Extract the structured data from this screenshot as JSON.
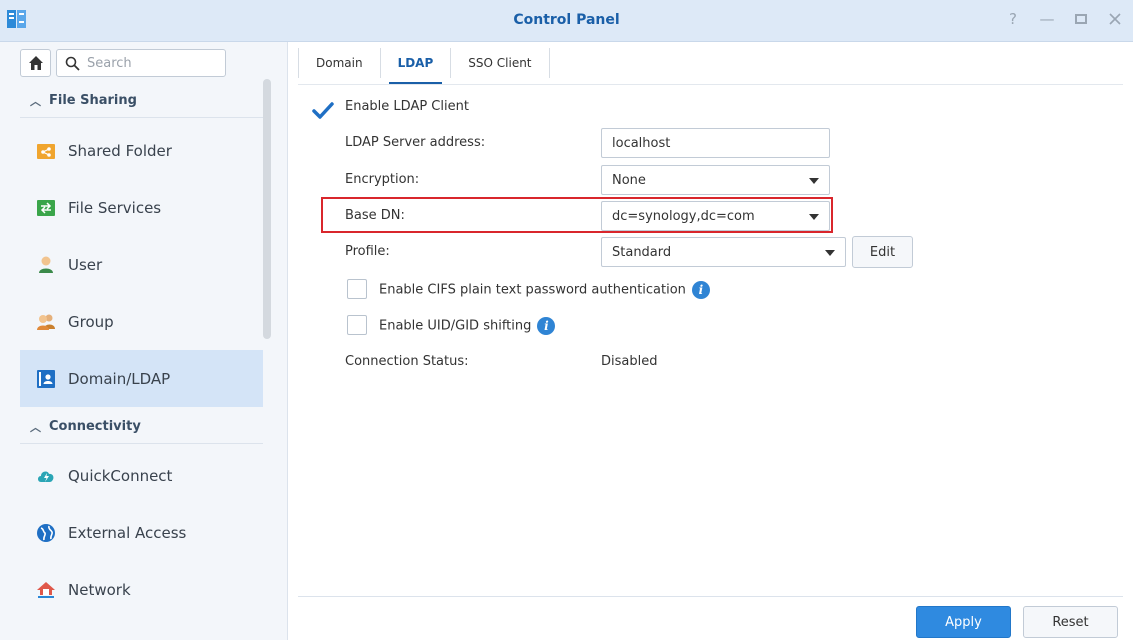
{
  "window": {
    "title": "Control Panel"
  },
  "colors": {
    "accent": "#1a5fa8",
    "primary_button": "#2f8ae0",
    "active_nav": "#d4e4f7",
    "highlight_border": "#d9262c"
  },
  "sidebar": {
    "search": {
      "placeholder": "Search"
    },
    "sections": [
      {
        "label": "File Sharing"
      },
      {
        "label": "Connectivity"
      }
    ],
    "items": [
      {
        "label": "Shared Folder",
        "icon": "shared-folder-icon"
      },
      {
        "label": "File Services",
        "icon": "file-services-icon"
      },
      {
        "label": "User",
        "icon": "user-icon"
      },
      {
        "label": "Group",
        "icon": "group-icon"
      },
      {
        "label": "Domain/LDAP",
        "icon": "domain-ldap-icon",
        "active": true
      },
      {
        "label": "QuickConnect",
        "icon": "quickconnect-icon"
      },
      {
        "label": "External Access",
        "icon": "external-access-icon"
      },
      {
        "label": "Network",
        "icon": "network-icon"
      }
    ]
  },
  "tabs": [
    {
      "label": "Domain"
    },
    {
      "label": "LDAP",
      "active": true
    },
    {
      "label": "SSO Client"
    }
  ],
  "form": {
    "enable_ldap": {
      "label": "Enable LDAP Client",
      "checked": true
    },
    "server_address": {
      "label": "LDAP Server address:",
      "value": "localhost"
    },
    "encryption": {
      "label": "Encryption:",
      "value": "None"
    },
    "base_dn": {
      "label": "Base DN:",
      "value": "dc=synology,dc=com"
    },
    "profile": {
      "label": "Profile:",
      "value": "Standard",
      "edit_label": "Edit"
    },
    "cifs": {
      "label": "Enable CIFS plain text password authentication",
      "checked": false
    },
    "uid_gid": {
      "label": "Enable UID/GID shifting",
      "checked": false
    },
    "connection_status": {
      "label": "Connection Status:",
      "value": "Disabled"
    }
  },
  "footer": {
    "apply_label": "Apply",
    "reset_label": "Reset"
  }
}
